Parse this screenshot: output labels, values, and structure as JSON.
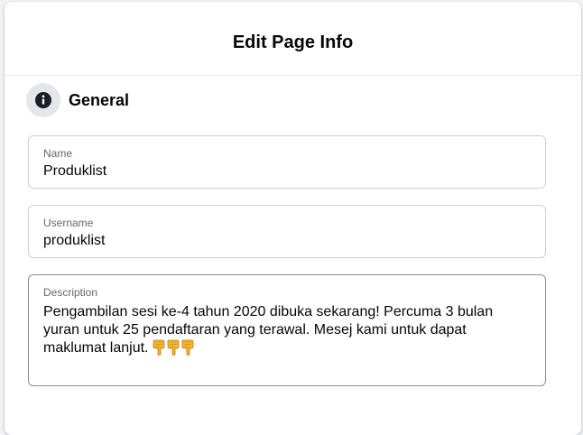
{
  "dialog": {
    "title": "Edit Page Info"
  },
  "section": {
    "title": "General",
    "icon": "info-icon"
  },
  "fields": {
    "name": {
      "label": "Name",
      "value": "Produklist"
    },
    "username": {
      "label": "Username",
      "value": "produklist"
    },
    "description": {
      "label": "Description",
      "value": "Pengambilan sesi ke-4 tahun 2020 dibuka sekarang! Percuma 3 bulan yuran untuk 25 pendaftaran yang terawal. Mesej kami untuk dapat maklumat lanjut.",
      "emoji_icon": "pointing-down-hand-icon",
      "emoji_count": 3
    }
  },
  "colors": {
    "emoji_fill": "#f7b928",
    "emoji_outline": "#b8741a"
  }
}
